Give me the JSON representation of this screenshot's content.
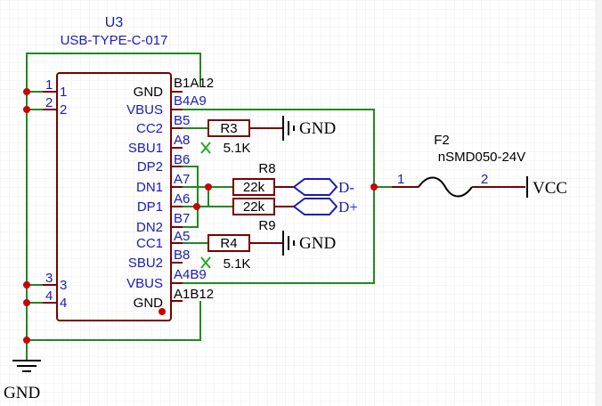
{
  "schematic": {
    "connector": {
      "designator": "U3",
      "part": "USB-TYPE-C-017",
      "left_pins": [
        "1",
        "2",
        "3",
        "4"
      ],
      "inner_pins": [
        "1",
        "2",
        "3",
        "4"
      ],
      "signals": [
        "GND",
        "VBUS",
        "CC2",
        "SBU1",
        "DP2",
        "DN1",
        "DP1",
        "DN2",
        "CC1",
        "SBU2",
        "VBUS",
        "GND"
      ],
      "right_pins": [
        "B1A12",
        "B4A9",
        "B5",
        "A8",
        "B6",
        "A7",
        "A6",
        "B7",
        "A5",
        "B8",
        "A4B9",
        "A1B12"
      ]
    },
    "resistors": {
      "r3": {
        "ref": "R3",
        "value": "5.1K"
      },
      "r4": {
        "ref": "R4",
        "value": "5.1K"
      },
      "r8": {
        "ref": "R8",
        "value": "22k"
      },
      "r9": {
        "ref": "R9",
        "value": "22k"
      }
    },
    "fuse": {
      "ref": "F2",
      "part": "nSMD050-24V",
      "pin1": "1",
      "pin2": "2"
    },
    "nets": {
      "gnd_top": "GND",
      "gnd_mid": "GND",
      "gnd_bottom": "GND",
      "dminus": "D-",
      "dplus": "D+",
      "vcc": "VCC"
    },
    "colors": {
      "wire": "#1f8a1f",
      "body": "#7a0000",
      "label_blue": "#1a1ab8",
      "junction": "#cc0000",
      "noconnect": "#22aa22"
    }
  }
}
